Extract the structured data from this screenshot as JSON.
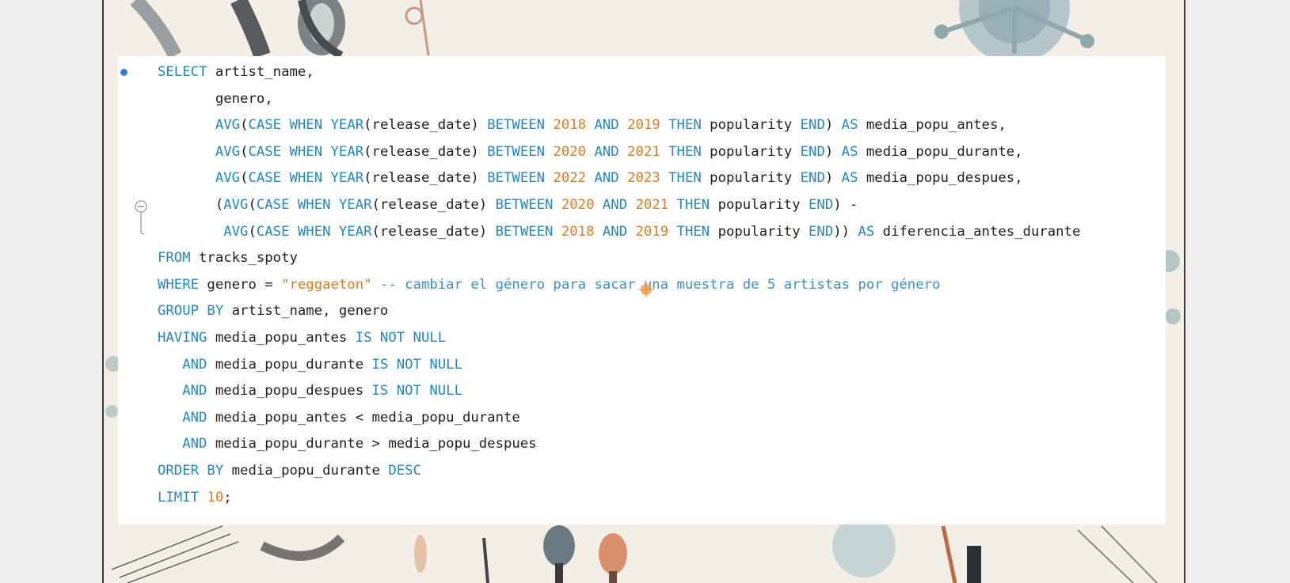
{
  "slide": {
    "accent": "#1f88c8",
    "number_color": "#e07b1e",
    "background": "#f3efe6"
  },
  "editor": {
    "gutter_icons": [
      "breakpoint-dot-icon",
      "fold-collapse-icon"
    ],
    "lines": [
      [
        [
          "kw",
          "SELECT"
        ],
        [
          "id",
          " artist_name,"
        ]
      ],
      [
        [
          "id",
          "       genero,"
        ]
      ],
      [
        [
          "id",
          "       "
        ],
        [
          "kw",
          "AVG"
        ],
        [
          "id",
          "("
        ],
        [
          "kw",
          "CASE WHEN YEAR"
        ],
        [
          "id",
          "(release_date) "
        ],
        [
          "kw",
          "BETWEEN"
        ],
        [
          "id",
          " "
        ],
        [
          "num",
          "2018"
        ],
        [
          "id",
          " "
        ],
        [
          "kw",
          "AND"
        ],
        [
          "id",
          " "
        ],
        [
          "num",
          "2019"
        ],
        [
          "id",
          " "
        ],
        [
          "kw",
          "THEN"
        ],
        [
          "id",
          " popularity "
        ],
        [
          "kw",
          "END"
        ],
        [
          "id",
          ") "
        ],
        [
          "kw",
          "AS"
        ],
        [
          "id",
          " media_popu_antes,"
        ]
      ],
      [
        [
          "id",
          "       "
        ],
        [
          "kw",
          "AVG"
        ],
        [
          "id",
          "("
        ],
        [
          "kw",
          "CASE WHEN YEAR"
        ],
        [
          "id",
          "(release_date) "
        ],
        [
          "kw",
          "BETWEEN"
        ],
        [
          "id",
          " "
        ],
        [
          "num",
          "2020"
        ],
        [
          "id",
          " "
        ],
        [
          "kw",
          "AND"
        ],
        [
          "id",
          " "
        ],
        [
          "num",
          "2021"
        ],
        [
          "id",
          " "
        ],
        [
          "kw",
          "THEN"
        ],
        [
          "id",
          " popularity "
        ],
        [
          "kw",
          "END"
        ],
        [
          "id",
          ") "
        ],
        [
          "kw",
          "AS"
        ],
        [
          "id",
          " media_popu_durante,"
        ]
      ],
      [
        [
          "id",
          "       "
        ],
        [
          "kw",
          "AVG"
        ],
        [
          "id",
          "("
        ],
        [
          "kw",
          "CASE WHEN YEAR"
        ],
        [
          "id",
          "(release_date) "
        ],
        [
          "kw",
          "BETWEEN"
        ],
        [
          "id",
          " "
        ],
        [
          "num",
          "2022"
        ],
        [
          "id",
          " "
        ],
        [
          "kw",
          "AND"
        ],
        [
          "id",
          " "
        ],
        [
          "num",
          "2023"
        ],
        [
          "id",
          " "
        ],
        [
          "kw",
          "THEN"
        ],
        [
          "id",
          " popularity "
        ],
        [
          "kw",
          "END"
        ],
        [
          "id",
          ") "
        ],
        [
          "kw",
          "AS"
        ],
        [
          "id",
          " media_popu_despues,"
        ]
      ],
      [
        [
          "id",
          "       ("
        ],
        [
          "kw",
          "AVG"
        ],
        [
          "id",
          "("
        ],
        [
          "kw",
          "CASE WHEN YEAR"
        ],
        [
          "id",
          "(release_date) "
        ],
        [
          "kw",
          "BETWEEN"
        ],
        [
          "id",
          " "
        ],
        [
          "num",
          "2020"
        ],
        [
          "id",
          " "
        ],
        [
          "kw",
          "AND"
        ],
        [
          "id",
          " "
        ],
        [
          "num",
          "2021"
        ],
        [
          "id",
          " "
        ],
        [
          "kw",
          "THEN"
        ],
        [
          "id",
          " popularity "
        ],
        [
          "kw",
          "END"
        ],
        [
          "id",
          ") -"
        ]
      ],
      [
        [
          "id",
          "        "
        ],
        [
          "kw",
          "AVG"
        ],
        [
          "id",
          "("
        ],
        [
          "kw",
          "CASE WHEN YEAR"
        ],
        [
          "id",
          "(release_date) "
        ],
        [
          "kw",
          "BETWEEN"
        ],
        [
          "id",
          " "
        ],
        [
          "num",
          "2018"
        ],
        [
          "id",
          " "
        ],
        [
          "kw",
          "AND"
        ],
        [
          "id",
          " "
        ],
        [
          "num",
          "2019"
        ],
        [
          "id",
          " "
        ],
        [
          "kw",
          "THEN"
        ],
        [
          "id",
          " popularity "
        ],
        [
          "kw",
          "END"
        ],
        [
          "id",
          "))"
        ],
        [
          "id",
          " "
        ],
        [
          "kw",
          "AS"
        ],
        [
          "id",
          " diferencia_antes_durante"
        ]
      ],
      [
        [
          "kw",
          "FROM"
        ],
        [
          "id",
          " tracks_spoty"
        ]
      ],
      [
        [
          "kw",
          "WHERE"
        ],
        [
          "id",
          " genero = "
        ],
        [
          "str",
          "\"reggaeton\""
        ],
        [
          "id",
          " "
        ],
        [
          "cmt",
          "-- cambiar el género para sacar una muestra de 5 artistas por género"
        ]
      ],
      [
        [
          "kw",
          "GROUP BY"
        ],
        [
          "id",
          " artist_name, genero"
        ]
      ],
      [
        [
          "kw",
          "HAVING"
        ],
        [
          "id",
          " media_popu_antes "
        ],
        [
          "kw",
          "IS NOT NULL"
        ]
      ],
      [
        [
          "id",
          "   "
        ],
        [
          "kw",
          "AND"
        ],
        [
          "id",
          " media_popu_durante "
        ],
        [
          "kw",
          "IS NOT NULL"
        ]
      ],
      [
        [
          "id",
          "   "
        ],
        [
          "kw",
          "AND"
        ],
        [
          "id",
          " media_popu_despues "
        ],
        [
          "kw",
          "IS NOT NULL"
        ]
      ],
      [
        [
          "id",
          "   "
        ],
        [
          "kw",
          "AND"
        ],
        [
          "id",
          " media_popu_antes < media_popu_durante"
        ]
      ],
      [
        [
          "id",
          "   "
        ],
        [
          "kw",
          "AND"
        ],
        [
          "id",
          " media_popu_durante > media_popu_despues"
        ]
      ],
      [
        [
          "kw",
          "ORDER BY"
        ],
        [
          "id",
          " media_popu_durante "
        ],
        [
          "kw",
          "DESC"
        ]
      ],
      [
        [
          "kw",
          "LIMIT"
        ],
        [
          "id",
          " "
        ],
        [
          "num",
          "10"
        ],
        [
          "id",
          ";"
        ]
      ]
    ]
  }
}
